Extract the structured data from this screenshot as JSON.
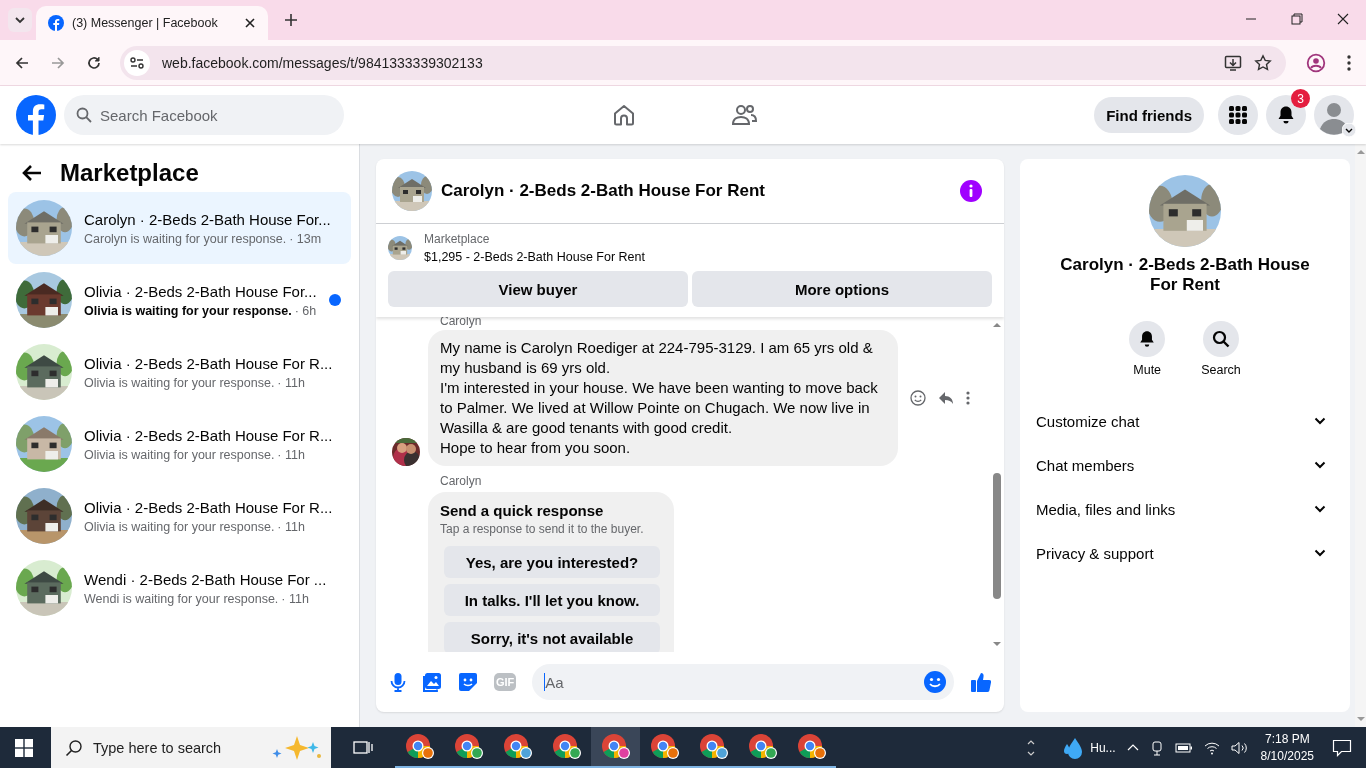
{
  "browser": {
    "tab_title": "(3) Messenger | Facebook",
    "url": "web.facebook.com/messages/t/9841333339302133"
  },
  "header": {
    "search_placeholder": "Search Facebook",
    "find_friends": "Find friends",
    "notification_count": "3"
  },
  "sidebar": {
    "title": "Marketplace",
    "items": [
      {
        "name": "Carolyn · 2-Beds 2-Bath House For...",
        "preview": "Carolyn is waiting for your response.",
        "time": "· 13m",
        "unread": false,
        "selected": true
      },
      {
        "name": "Olivia · 2-Beds 2-Bath House For...",
        "preview": "Olivia is waiting for your response.",
        "time": "· 6h",
        "unread": true,
        "selected": false
      },
      {
        "name": "Olivia · 2-Beds 2-Bath House For R...",
        "preview": "Olivia is waiting for your response.",
        "time": "· 11h",
        "unread": false,
        "selected": false
      },
      {
        "name": "Olivia · 2-Beds 2-Bath House For R...",
        "preview": "Olivia is waiting for your response.",
        "time": "· 11h",
        "unread": false,
        "selected": false
      },
      {
        "name": "Olivia · 2-Beds 2-Bath House For R...",
        "preview": "Olivia is waiting for your response.",
        "time": "· 11h",
        "unread": false,
        "selected": false
      },
      {
        "name": "Wendi · 2-Beds 2-Bath House For ...",
        "preview": "Wendi is waiting for your response.",
        "time": "· 11h",
        "unread": false,
        "selected": false
      }
    ]
  },
  "chat": {
    "title": "Carolyn · 2-Beds 2-Bath House For Rent",
    "listing_source": "Marketplace",
    "listing": "$1,295 - 2-Beds 2-Bath House For Rent",
    "buttons": [
      "View buyer",
      "More options"
    ],
    "message": {
      "sender": "Carolyn",
      "text": "My name is Carolyn Roediger at 224-795-3129. I am 65 yrs old & my husband is 69 yrs old.\nI'm interested in your house. We have been wanting to move back to Palmer. We lived at Willow Pointe on Chugach. We now live in Wasilla & are good tenants with good credit.\nHope to hear from you soon."
    },
    "quick": {
      "sender": "Carolyn",
      "title": "Send a quick response",
      "hint": "Tap a response to send it to the buyer.",
      "responses": [
        "Yes, are you interested?",
        "In talks. I'll let you know.",
        "Sorry, it's not available"
      ]
    },
    "composer": {
      "placeholder": "Aa",
      "gif_label": "GIF"
    }
  },
  "details": {
    "title": "Carolyn · 2-Beds 2-Bath House For Rent",
    "actions": [
      "Mute",
      "Search"
    ],
    "sections": [
      "Customize chat",
      "Chat members",
      "Media, files and links",
      "Privacy & support"
    ]
  },
  "taskbar": {
    "search_placeholder": "Type here to search",
    "apps": [
      {
        "color": "#e8710a",
        "selected": false
      },
      {
        "color": "#34a853",
        "selected": false
      },
      {
        "color": "#4fa3d8",
        "selected": false
      },
      {
        "color": "#34a853",
        "selected": false
      },
      {
        "color": "#e040a0",
        "selected": true
      },
      {
        "color": "#e8710a",
        "selected": false
      },
      {
        "color": "#4fa3d8",
        "selected": false
      },
      {
        "color": "#34a853",
        "selected": false
      },
      {
        "color": "#e8710a",
        "selected": false
      }
    ],
    "weather": "Hu...",
    "time": "7:18 PM",
    "date": "8/10/2025"
  }
}
